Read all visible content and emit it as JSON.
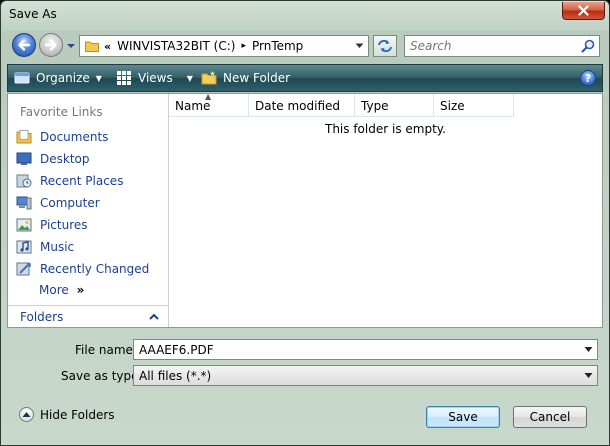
{
  "window": {
    "title": "Save As"
  },
  "nav": {
    "breadcrumb_chevron": "«",
    "drive": "WINVISTA32BIT (C:)",
    "separator": "▸",
    "folder": "PrnTemp",
    "search_placeholder": "Search"
  },
  "toolbar": {
    "organize_label": "Organize",
    "views_label": "Views",
    "new_folder_label": "New Folder",
    "help_label": "?"
  },
  "sidebar": {
    "header": "Favorite Links",
    "items": [
      {
        "label": "Documents",
        "icon": "documents-icon"
      },
      {
        "label": "Desktop",
        "icon": "desktop-icon"
      },
      {
        "label": "Recent Places",
        "icon": "recent-places-icon"
      },
      {
        "label": "Computer",
        "icon": "computer-icon"
      },
      {
        "label": "Pictures",
        "icon": "pictures-icon"
      },
      {
        "label": "Music",
        "icon": "music-icon"
      },
      {
        "label": "Recently Changed",
        "icon": "recently-changed-icon"
      }
    ],
    "more_label": "More",
    "more_glyph": "»",
    "folders_label": "Folders"
  },
  "filelist": {
    "columns": [
      "Name",
      "Date modified",
      "Type",
      "Size"
    ],
    "sorted_column": "Name",
    "empty_message": "This folder is empty."
  },
  "form": {
    "filename_label": "File name:",
    "filename_value": "AAAEF6.PDF",
    "filetype_label": "Save as type:",
    "filetype_value": "All files (*.*)"
  },
  "footer": {
    "hide_folders_label": "Hide Folders",
    "save_label": "Save",
    "cancel_label": "Cancel"
  },
  "colors": {
    "accent_link": "#1c3f94",
    "toolbar": "#345e68",
    "close_button": "#c8442a"
  }
}
